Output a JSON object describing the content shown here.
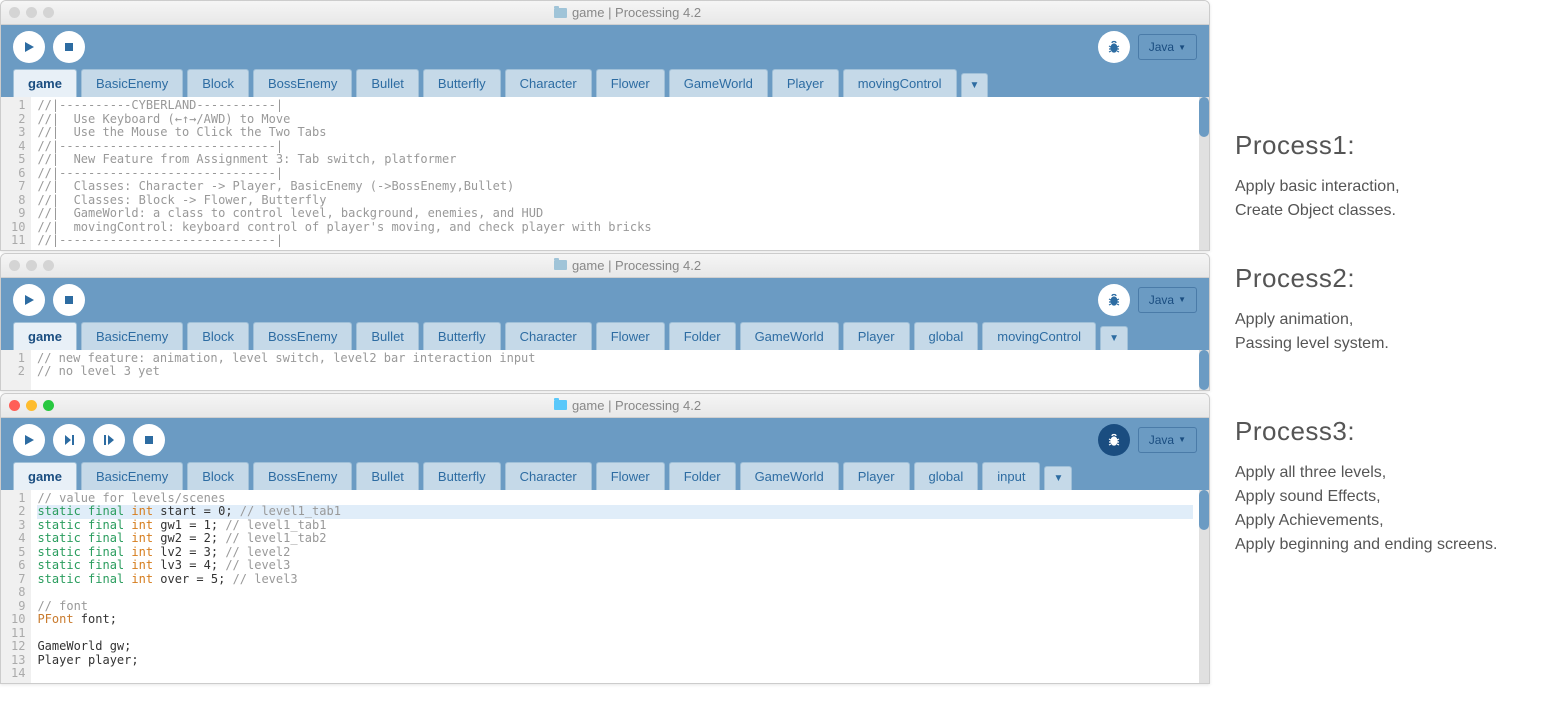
{
  "windows": [
    {
      "active": false,
      "title": "game | Processing 4.2",
      "folderClass": "folder-icon",
      "debugDark": false,
      "mode": "Java",
      "buttons": [
        "run",
        "stop"
      ],
      "tabs": [
        "game",
        "BasicEnemy",
        "Block",
        "BossEnemy",
        "Bullet",
        "Butterfly",
        "Character",
        "Flower",
        "GameWorld",
        "Player",
        "movingControl"
      ],
      "activeTab": 0,
      "scrollThumbTop": 0,
      "lines": [
        {
          "n": 1,
          "html": "<span class='cm'>//|----------CYBERLAND-----------|</span>"
        },
        {
          "n": 2,
          "html": "<span class='cm'>//|  Use Keyboard (←↑→/AWD) to Move</span>"
        },
        {
          "n": 3,
          "html": "<span class='cm'>//|  Use the Mouse to Click the Two Tabs</span>"
        },
        {
          "n": 4,
          "html": "<span class='cm'>//|------------------------------|</span>"
        },
        {
          "n": 5,
          "html": "<span class='cm'>//|  New Feature from Assignment 3: Tab switch, platformer</span>"
        },
        {
          "n": 6,
          "html": "<span class='cm'>//|------------------------------|</span>"
        },
        {
          "n": 7,
          "html": "<span class='cm'>//|  Classes: Character -> Player, BasicEnemy (->BossEnemy,Bullet)</span>"
        },
        {
          "n": 8,
          "html": "<span class='cm'>//|  Classes: Block -> Flower, Butterfly</span>"
        },
        {
          "n": 9,
          "html": "<span class='cm'>//|  GameWorld: a class to control level, background, enemies, and HUD</span>"
        },
        {
          "n": 10,
          "html": "<span class='cm'>//|  movingControl: keyboard control of player's moving, and check player with bricks</span>"
        },
        {
          "n": 11,
          "html": "<span class='cm'>//|------------------------------|</span>"
        }
      ]
    },
    {
      "active": false,
      "title": "game | Processing 4.2",
      "folderClass": "folder-icon",
      "debugDark": false,
      "mode": "Java",
      "buttons": [
        "run",
        "stop"
      ],
      "tabs": [
        "game",
        "BasicEnemy",
        "Block",
        "BossEnemy",
        "Bullet",
        "Butterfly",
        "Character",
        "Flower",
        "Folder",
        "GameWorld",
        "Player",
        "global",
        "movingControl"
      ],
      "activeTab": 0,
      "scrollThumbTop": 0,
      "lines": [
        {
          "n": 1,
          "html": "<span class='cm'>// new feature: animation, level switch, level2 bar interaction input</span>"
        },
        {
          "n": 2,
          "html": "<span class='cm'>// no level 3 yet</span>"
        }
      ]
    },
    {
      "active": true,
      "title": "game | Processing 4.2",
      "folderClass": "folder-icon blue",
      "debugDark": true,
      "mode": "Java",
      "buttons": [
        "run",
        "step",
        "step-over",
        "stop"
      ],
      "tabs": [
        "game",
        "BasicEnemy",
        "Block",
        "BossEnemy",
        "Bullet",
        "Butterfly",
        "Character",
        "Flower",
        "Folder",
        "GameWorld",
        "Player",
        "global",
        "input"
      ],
      "activeTab": 0,
      "scrollThumbTop": 0,
      "lines": [
        {
          "n": 1,
          "html": "<span class='cm'>// value for levels/scenes</span>"
        },
        {
          "n": 2,
          "hl": true,
          "html": "<span class='kw'>static final</span> <span class='ty'>int</span> start = 0; <span class='cm'>// level1_tab1</span>"
        },
        {
          "n": 3,
          "html": "<span class='kw'>static final</span> <span class='ty'>int</span> gw1 = 1; <span class='cm'>// level1_tab1</span>"
        },
        {
          "n": 4,
          "html": "<span class='kw'>static final</span> <span class='ty'>int</span> gw2 = 2; <span class='cm'>// level1_tab2</span>"
        },
        {
          "n": 5,
          "html": "<span class='kw'>static final</span> <span class='ty'>int</span> lv2 = 3; <span class='cm'>// level2</span>"
        },
        {
          "n": 6,
          "html": "<span class='kw'>static final</span> <span class='ty'>int</span> lv3 = 4; <span class='cm'>// level3</span>"
        },
        {
          "n": 7,
          "html": "<span class='kw'>static final</span> <span class='ty'>int</span> over = 5; <span class='cm'>// level3</span>"
        },
        {
          "n": 8,
          "html": " "
        },
        {
          "n": 9,
          "html": "<span class='cm'>// font</span>"
        },
        {
          "n": 10,
          "html": "<span class='cl'>PFont</span> font;"
        },
        {
          "n": 11,
          "html": " "
        },
        {
          "n": 12,
          "html": "GameWorld gw;"
        },
        {
          "n": 13,
          "html": "Player player;"
        },
        {
          "n": 14,
          "html": " "
        }
      ]
    }
  ],
  "side": [
    {
      "cls": "block1",
      "title": "Process1:",
      "body": "Apply basic interaction,\nCreate Object classes."
    },
    {
      "cls": "block2",
      "title": "Process2:",
      "body": "Apply animation,\nPassing level system."
    },
    {
      "cls": "block3",
      "title": "Process3:",
      "body": "Apply all three levels,\nApply sound Effects,\nApply Achievements,\nApply beginning and ending screens."
    }
  ],
  "icons": {
    "run": "<svg viewBox='0 0 14 14'><path d='M3 2 L12 7 L3 12 Z'/></svg>",
    "stop": "<svg viewBox='0 0 14 14'><rect x='3' y='3' width='8' height='8'/></svg>",
    "step": "<svg viewBox='0 0 14 14'><path d='M3 2 L9 7 L3 12 Z'/><rect x='10' y='2' width='2' height='10'/></svg>",
    "step-over": "<svg viewBox='0 0 14 14'><rect x='2' y='2' width='2' height='10'/><path d='M6 2 L12 7 L6 12 Z'/></svg>",
    "debug": "<svg viewBox='0 0 16 16'><g stroke='#2d6ca2' stroke-width='1.2' fill='none'><path d='M6 4 C6 2 10 2 10 4'/><ellipse cx='8' cy='9' rx='3' ry='4' fill='#2d6ca2'/><path d='M3 7 L5 8 M3 10 L5 10 M3 13 L5 12 M13 7 L11 8 M13 10 L11 10 M13 13 L11 12'/></g></svg>",
    "debug-dark": "<svg viewBox='0 0 16 16'><g stroke='#fff' stroke-width='1.2' fill='none'><path d='M6 4 C6 2 10 2 10 4'/><ellipse cx='8' cy='9' rx='3' ry='4' fill='#fff'/><path d='M3 7 L5 8 M3 10 L5 10 M3 13 L5 12 M13 7 L11 8 M13 10 L11 10 M13 13 L11 12'/></g></svg>"
  }
}
